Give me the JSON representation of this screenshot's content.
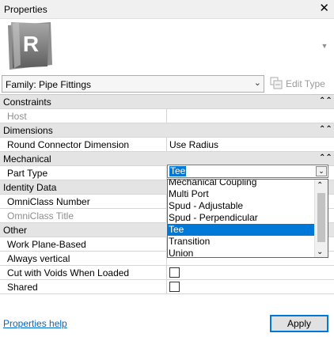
{
  "window": {
    "title": "Properties",
    "close_glyph": "✕"
  },
  "thumbnail": {
    "logo_letter": "R",
    "logo_icon": "revit-logo-icon"
  },
  "type_selector": {
    "value": "Family: Pipe Fittings",
    "edit_type_label": "Edit Type"
  },
  "properties": {
    "sections": [
      {
        "label": "Constraints",
        "collapse_glyph": "⌃"
      },
      {
        "label": "Dimensions",
        "collapse_glyph": "⌃"
      },
      {
        "label": "Mechanical",
        "collapse_glyph": "⌃"
      },
      {
        "label": "Identity Data",
        "collapse_glyph": "⌃"
      },
      {
        "label": "Other",
        "collapse_glyph": "⌃"
      }
    ],
    "host": {
      "label": "Host",
      "value": ""
    },
    "round_connector": {
      "label": "Round Connector Dimension",
      "value": "Use Radius"
    },
    "part_type": {
      "label": "Part Type",
      "value": "Tee"
    },
    "omniclass_number": {
      "label": "OmniClass Number"
    },
    "omniclass_title": {
      "label": "OmniClass Title"
    },
    "work_plane": {
      "label": "Work Plane-Based",
      "checked": false
    },
    "always_vertical": {
      "label": "Always vertical",
      "checked": true
    },
    "cut_voids": {
      "label": "Cut with Voids When Loaded",
      "checked": false
    },
    "shared": {
      "label": "Shared",
      "checked": false
    }
  },
  "part_type_dropdown": {
    "options": [
      "Mechanical Coupling",
      "Multi Port",
      "Spud - Adjustable",
      "Spud - Perpendicular",
      "Tee",
      "Transition",
      "Union"
    ],
    "highlighted": "Tee",
    "accent_color": "#0078d7"
  },
  "footer": {
    "help_link": "Properties help",
    "apply_label": "Apply"
  }
}
